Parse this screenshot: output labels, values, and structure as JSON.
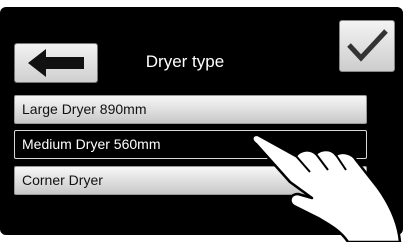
{
  "header": {
    "title": "Dryer type",
    "back_icon": "arrow-left-icon",
    "confirm_icon": "checkmark-icon"
  },
  "options": [
    {
      "label": "Large Dryer 890mm",
      "selected": false
    },
    {
      "label": "Medium Dryer 560mm",
      "selected": true
    },
    {
      "label": "Corner Dryer",
      "selected": false
    }
  ],
  "overlay": {
    "icon": "hand-pointer-icon"
  },
  "colors": {
    "screen_bg": "#000000",
    "selected_text": "#ffffff"
  }
}
